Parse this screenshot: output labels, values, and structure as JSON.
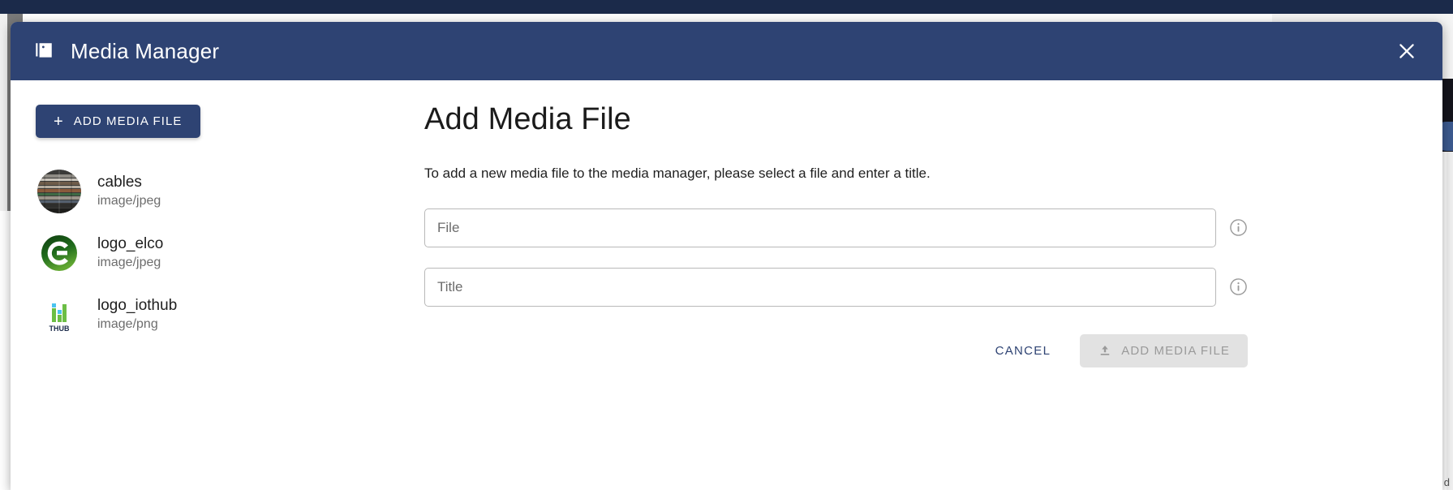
{
  "modal": {
    "title": "Media Manager",
    "header_icon": "image-collection-icon",
    "close_icon": "close-icon",
    "accent_color": "#2e4373"
  },
  "sidebar": {
    "add_button": {
      "label": "ADD MEDIA FILE",
      "icon": "plus-icon"
    },
    "items": [
      {
        "name": "cables",
        "type": "image/jpeg",
        "thumb": "cables-thumbnail"
      },
      {
        "name": "logo_elco",
        "type": "image/jpeg",
        "thumb": "elco-logo-thumbnail"
      },
      {
        "name": "logo_iothub",
        "type": "image/png",
        "thumb": "iothub-logo-thumbnail"
      }
    ]
  },
  "main": {
    "title": "Add Media File",
    "description": "To add a new media file to the media manager, please select a file and enter a title.",
    "fields": [
      {
        "placeholder": "File",
        "value": "",
        "info_icon": "info-icon"
      },
      {
        "placeholder": "Title",
        "value": "",
        "info_icon": "info-icon"
      }
    ],
    "actions": {
      "cancel_label": "CANCEL",
      "submit_label": "ADD MEDIA FILE",
      "submit_icon": "upload-icon",
      "submit_disabled": true
    }
  },
  "background": {
    "edge_text": "d"
  }
}
